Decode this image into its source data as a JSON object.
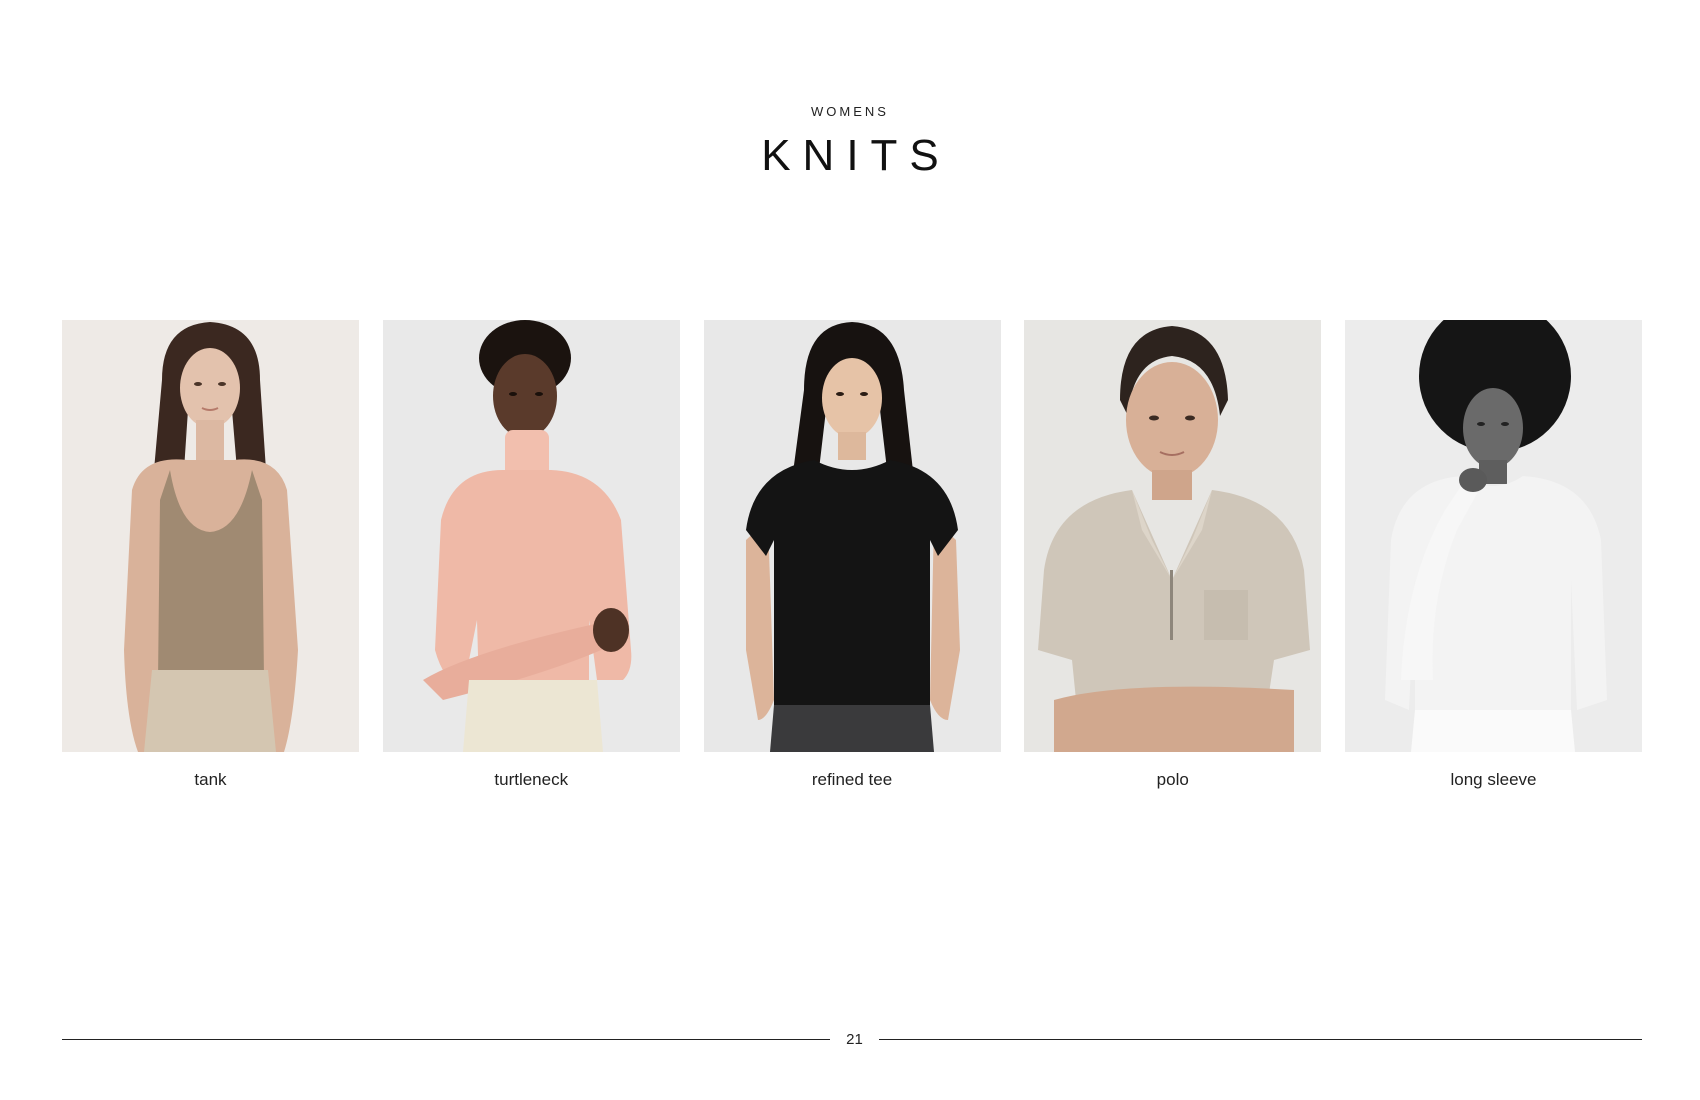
{
  "header": {
    "eyebrow": "WOMENS",
    "title": "KNITS"
  },
  "products": [
    {
      "caption": "tank",
      "photo_alt": "tank",
      "top_color": "#a08a72",
      "bg_color": "#eeeae6"
    },
    {
      "caption": "turtleneck",
      "photo_alt": "turtleneck",
      "top_color": "#efb9a7",
      "bg_color": "#e9e9e9"
    },
    {
      "caption": "refined tee",
      "photo_alt": "refined tee",
      "top_color": "#141414",
      "bg_color": "#e8e8e8"
    },
    {
      "caption": "polo",
      "photo_alt": "polo",
      "top_color": "#cfc6b9",
      "bg_color": "#e7e6e3"
    },
    {
      "caption": "long sleeve",
      "photo_alt": "long sleeve",
      "top_color": "#f3f3f3",
      "bg_color": "#ececec"
    }
  ],
  "footer": {
    "page_number": "21"
  }
}
